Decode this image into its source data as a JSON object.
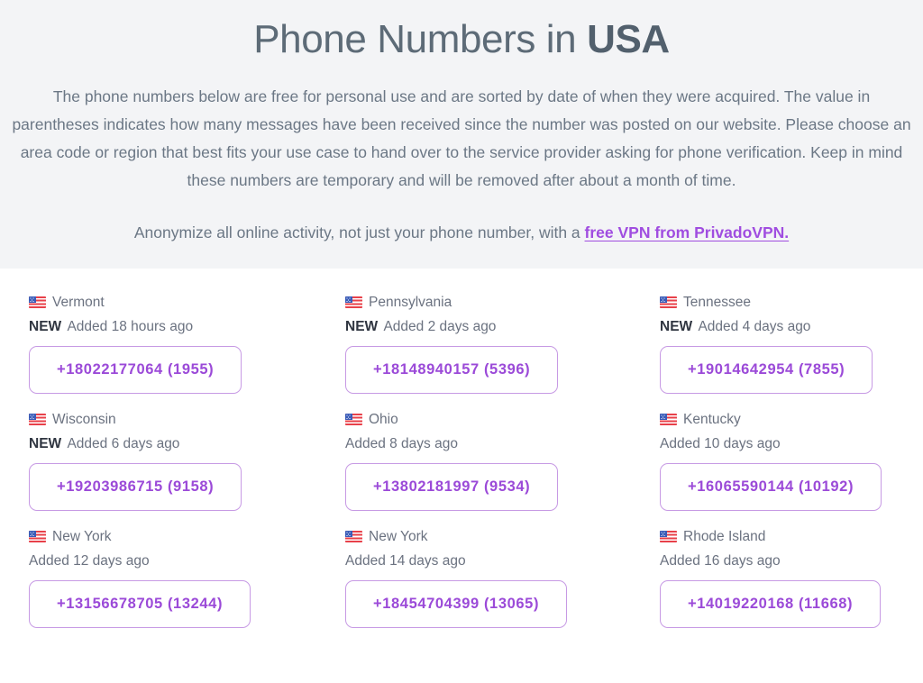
{
  "header": {
    "title_prefix": "Phone Numbers in ",
    "title_strong": "USA",
    "intro": "The phone numbers below are free for personal use and are sorted by date of when they were acquired. The value in parentheses indicates how many messages have been received since the number was posted on our website. Please choose an area code or region that best fits your use case to hand over to the service provider asking for phone verification. Keep in mind these numbers are temporary and will be removed after about a month of time.",
    "vpn_text": "Anonymize all online activity, not just your phone number, with a ",
    "vpn_link": "free VPN from PrivadoVPN.",
    "background_color": "#f3f4f6",
    "title_color": "#5d6b77",
    "link_color": "#a04de0"
  },
  "theme": {
    "accent": "#9b4ad8",
    "border": "#c79ae4",
    "muted_text": "#6b7280",
    "badge_text": "#2f3540"
  },
  "cards": [
    {
      "flag_icon": "us-flag-icon",
      "region": "Vermont",
      "badge": "NEW",
      "added": "Added 18 hours ago",
      "number": "+18022177064 (1955)"
    },
    {
      "flag_icon": "us-flag-icon",
      "region": "Pennsylvania",
      "badge": "NEW",
      "added": "Added 2 days ago",
      "number": "+18148940157 (5396)"
    },
    {
      "flag_icon": "us-flag-icon",
      "region": "Tennessee",
      "badge": "NEW",
      "added": "Added 4 days ago",
      "number": "+19014642954 (7855)"
    },
    {
      "flag_icon": "us-flag-icon",
      "region": "Wisconsin",
      "badge": "NEW",
      "added": "Added 6 days ago",
      "number": "+19203986715 (9158)"
    },
    {
      "flag_icon": "us-flag-icon",
      "region": "Ohio",
      "badge": "",
      "added": "Added 8 days ago",
      "number": "+13802181997 (9534)"
    },
    {
      "flag_icon": "us-flag-icon",
      "region": "Kentucky",
      "badge": "",
      "added": "Added 10 days ago",
      "number": "+16065590144 (10192)"
    },
    {
      "flag_icon": "us-flag-icon",
      "region": "New York",
      "badge": "",
      "added": "Added 12 days ago",
      "number": "+13156678705 (13244)"
    },
    {
      "flag_icon": "us-flag-icon",
      "region": "New York",
      "badge": "",
      "added": "Added 14 days ago",
      "number": "+18454704399 (13065)"
    },
    {
      "flag_icon": "us-flag-icon",
      "region": "Rhode Island",
      "badge": "",
      "added": "Added 16 days ago",
      "number": "+14019220168 (11668)"
    }
  ]
}
